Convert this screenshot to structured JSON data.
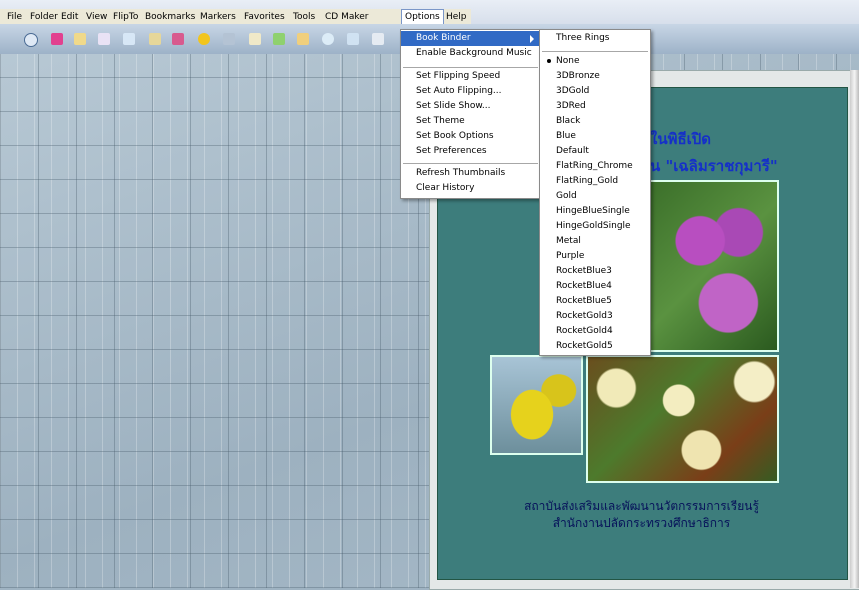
{
  "menubar": {
    "items": [
      {
        "label": "File"
      },
      {
        "label": "Folder"
      },
      {
        "label": "Edit"
      },
      {
        "label": "View"
      },
      {
        "label": "FlipTo"
      },
      {
        "label": "Bookmarks"
      },
      {
        "label": "Markers"
      },
      {
        "label": "Favorites"
      },
      {
        "label": "Tools"
      },
      {
        "label": "CD Maker"
      },
      {
        "label": "Options"
      },
      {
        "label": "Help"
      }
    ]
  },
  "options_menu": {
    "items": [
      {
        "label": "Book Binder"
      },
      {
        "label": "Enable Background Music"
      },
      {
        "label": "Set Flipping Speed"
      },
      {
        "label": "Set Auto Flipping..."
      },
      {
        "label": "Set Slide Show..."
      },
      {
        "label": "Set Theme"
      },
      {
        "label": "Set Book Options"
      },
      {
        "label": "Set Preferences"
      },
      {
        "label": "Refresh Thumbnails"
      },
      {
        "label": "Clear History"
      }
    ]
  },
  "binder_menu": {
    "header": "Three Rings",
    "selected": "None",
    "items": [
      "None",
      "3DBronze",
      "3DGold",
      "3DRed",
      "Black",
      "Blue",
      "Default",
      "FlatRing_Chrome",
      "FlatRing_Gold",
      "Gold",
      "HingeBlueSingle",
      "HingeGoldSingle",
      "Metal",
      "Purple",
      "RocketBlue3",
      "RocketBlue4",
      "RocketBlue5",
      "RocketGold3",
      "RocketGold4",
      "RocketGold5"
    ]
  },
  "book": {
    "title_line1": "ในพิธีเปิด",
    "title_line2": "น \"เฉลิมราชกุมารี\"",
    "footer_line1": "สถาบันส่งเสริมและพัฒนานวัตกรรมการเรียนรู้",
    "footer_line2": "สำนักงานปลัดกระทรวงศึกษาธิการ"
  },
  "toolbar_icons": [
    "eye-icon",
    "book-pink-icon",
    "book-open-icon",
    "book-icon",
    "page-arrow-icon",
    "book-flip-icon",
    "clipboard-icon",
    "add-icon",
    "pencil-icon",
    "book-pages-icon",
    "marker-icon",
    "favorites-icon",
    "search-icon",
    "dialog-icon",
    "window-icon"
  ]
}
